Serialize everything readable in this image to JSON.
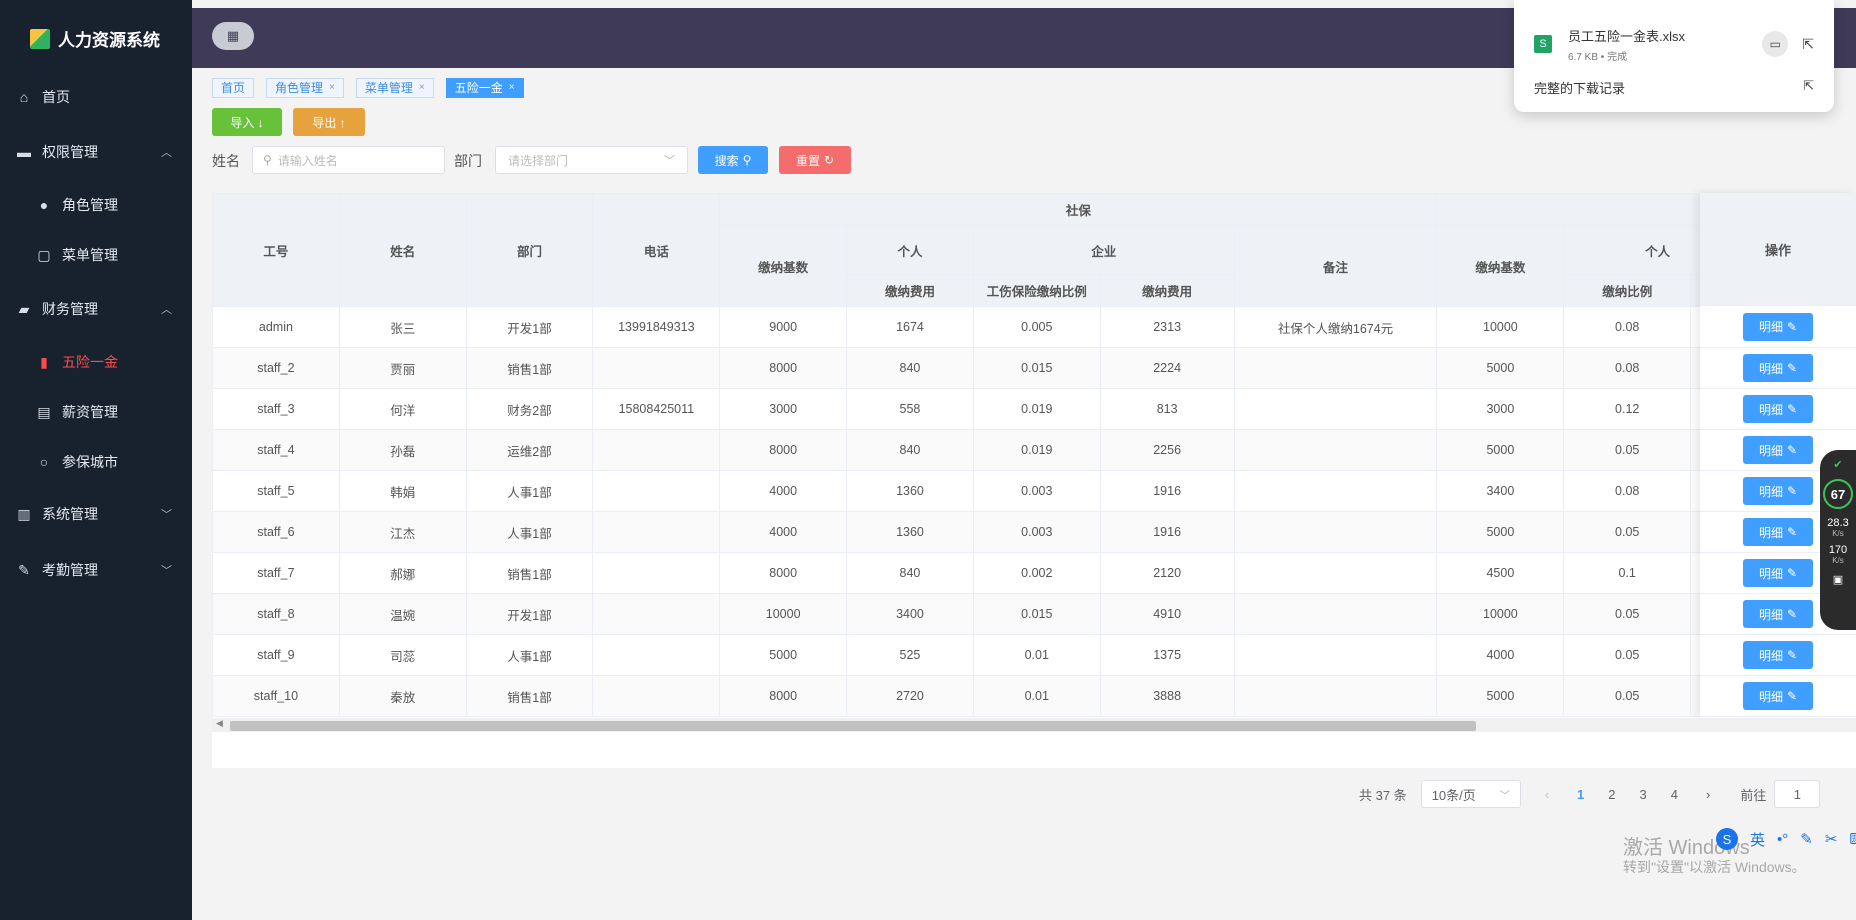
{
  "app": {
    "title": "人力资源系统"
  },
  "sidebar": {
    "items": [
      {
        "label": "首页",
        "icon": "home-icon"
      },
      {
        "label": "权限管理",
        "icon": "briefcase-icon"
      },
      {
        "label": "角色管理",
        "icon": "user-icon"
      },
      {
        "label": "菜单管理",
        "icon": "menu-doc-icon"
      },
      {
        "label": "财务管理",
        "icon": "wallet-icon"
      },
      {
        "label": "五险一金",
        "icon": "bar-chart-icon"
      },
      {
        "label": "薪资管理",
        "icon": "chart-board-icon"
      },
      {
        "label": "参保城市",
        "icon": "location-user-icon"
      },
      {
        "label": "系统管理",
        "icon": "building-icon"
      },
      {
        "label": "考勤管理",
        "icon": "pen-icon"
      }
    ]
  },
  "tags": [
    "首页",
    "角色管理",
    "菜单管理",
    "五险一金"
  ],
  "toolbar": {
    "import_label": "导入 ↓",
    "export_label": "导出 ↑"
  },
  "filters": {
    "name_label": "姓名",
    "name_placeholder": "请输入姓名",
    "dept_label": "部门",
    "dept_placeholder": "请选择部门",
    "search_label": "搜索",
    "reset_label": "重置"
  },
  "table": {
    "headers": {
      "id": "工号",
      "name": "姓名",
      "dept": "部门",
      "phone": "电话",
      "social": "社保",
      "base": "缴纳基数",
      "personal": "个人",
      "company": "企业",
      "pay_fee": "缴纳费用",
      "injury_ratio": "工伤保险缴纳比例",
      "company_fee": "缴纳费用",
      "remark": "备注",
      "base2": "缴纳基数",
      "personal2": "个人",
      "ratio": "缴纳比例",
      "op": "操作"
    },
    "rows": [
      [
        "admin",
        "张三",
        "开发1部",
        "13991849313",
        "9000",
        "1674",
        "0.005",
        "2313",
        "社保个人缴纳1674元",
        "10000",
        "0.08"
      ],
      [
        "staff_2",
        "贾丽",
        "销售1部",
        "",
        "8000",
        "840",
        "0.015",
        "2224",
        "",
        "5000",
        "0.08"
      ],
      [
        "staff_3",
        "何洋",
        "财务2部",
        "15808425011",
        "3000",
        "558",
        "0.019",
        "813",
        "",
        "3000",
        "0.12"
      ],
      [
        "staff_4",
        "孙磊",
        "运维2部",
        "",
        "8000",
        "840",
        "0.019",
        "2256",
        "",
        "5000",
        "0.05"
      ],
      [
        "staff_5",
        "韩娟",
        "人事1部",
        "",
        "4000",
        "1360",
        "0.003",
        "1916",
        "",
        "3400",
        "0.08"
      ],
      [
        "staff_6",
        "江杰",
        "人事1部",
        "",
        "4000",
        "1360",
        "0.003",
        "1916",
        "",
        "5000",
        "0.05"
      ],
      [
        "staff_7",
        "郝娜",
        "销售1部",
        "",
        "8000",
        "840",
        "0.002",
        "2120",
        "",
        "4500",
        "0.1"
      ],
      [
        "staff_8",
        "温婉",
        "开发1部",
        "",
        "10000",
        "3400",
        "0.015",
        "4910",
        "",
        "10000",
        "0.05"
      ],
      [
        "staff_9",
        "司蕊",
        "人事1部",
        "",
        "5000",
        "525",
        "0.01",
        "1375",
        "",
        "4000",
        "0.05"
      ],
      [
        "staff_10",
        "秦放",
        "销售1部",
        "",
        "8000",
        "2720",
        "0.01",
        "3888",
        "",
        "5000",
        "0.05"
      ]
    ],
    "detail_label": "明细"
  },
  "pagination": {
    "total": "共 37 条",
    "page_size": "10条/页",
    "pages": [
      "1",
      "2",
      "3",
      "4"
    ],
    "goto_label": "前往",
    "goto_value": "1"
  },
  "download_panel": {
    "file_name": "员工五险一金表.xlsx",
    "file_meta": "6.7 KB • 完成",
    "history_link": "完整的下载记录"
  },
  "watermark": {
    "line1": "激活 Windows",
    "line2": "转到\"设置\"以激活 Windows。"
  },
  "widget": {
    "percent": "67",
    "up": "28.3",
    "down": "170",
    "unit": "K/s"
  },
  "colors": {
    "sidebar_bg": "#18222e",
    "topbar_bg": "#3f3a58",
    "primary": "#409eff",
    "active_menu": "#ff4b4b"
  }
}
